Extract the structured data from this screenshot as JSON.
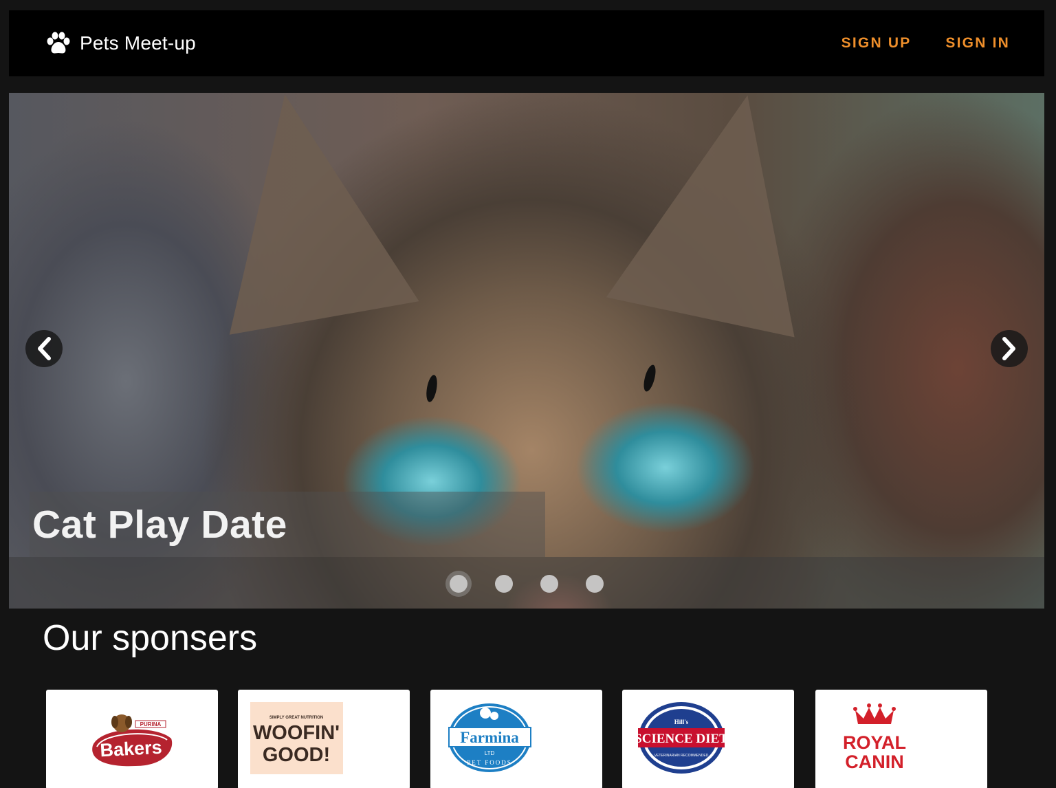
{
  "header": {
    "brand": "Pets Meet-up",
    "sign_up": "SIGN UP",
    "sign_in": "SIGN IN"
  },
  "carousel": {
    "caption": "Cat Play Date",
    "slide_count": 4,
    "active_index": 0
  },
  "sponsors": {
    "title": "Our sponsers",
    "logos": {
      "bakers": {
        "tag": "PURINA",
        "name": "Bakers"
      },
      "woofin": {
        "tag": "SIMPLY GREAT NUTRITION",
        "line1": "WOOFIN'",
        "line2": "GOOD!"
      },
      "farmina": {
        "name": "Farmina",
        "ltd": "LTD",
        "sub": "PET FOODS"
      },
      "hills": {
        "top": "Hill's",
        "name": "SCIENCE DIET",
        "sub": "VETERINARIAN RECOMMENDED"
      },
      "royal": {
        "line1": "ROYAL",
        "line2": "CANIN"
      }
    }
  },
  "colors": {
    "accent": "#ef8f2b",
    "background": "#141414",
    "header": "#000000"
  }
}
